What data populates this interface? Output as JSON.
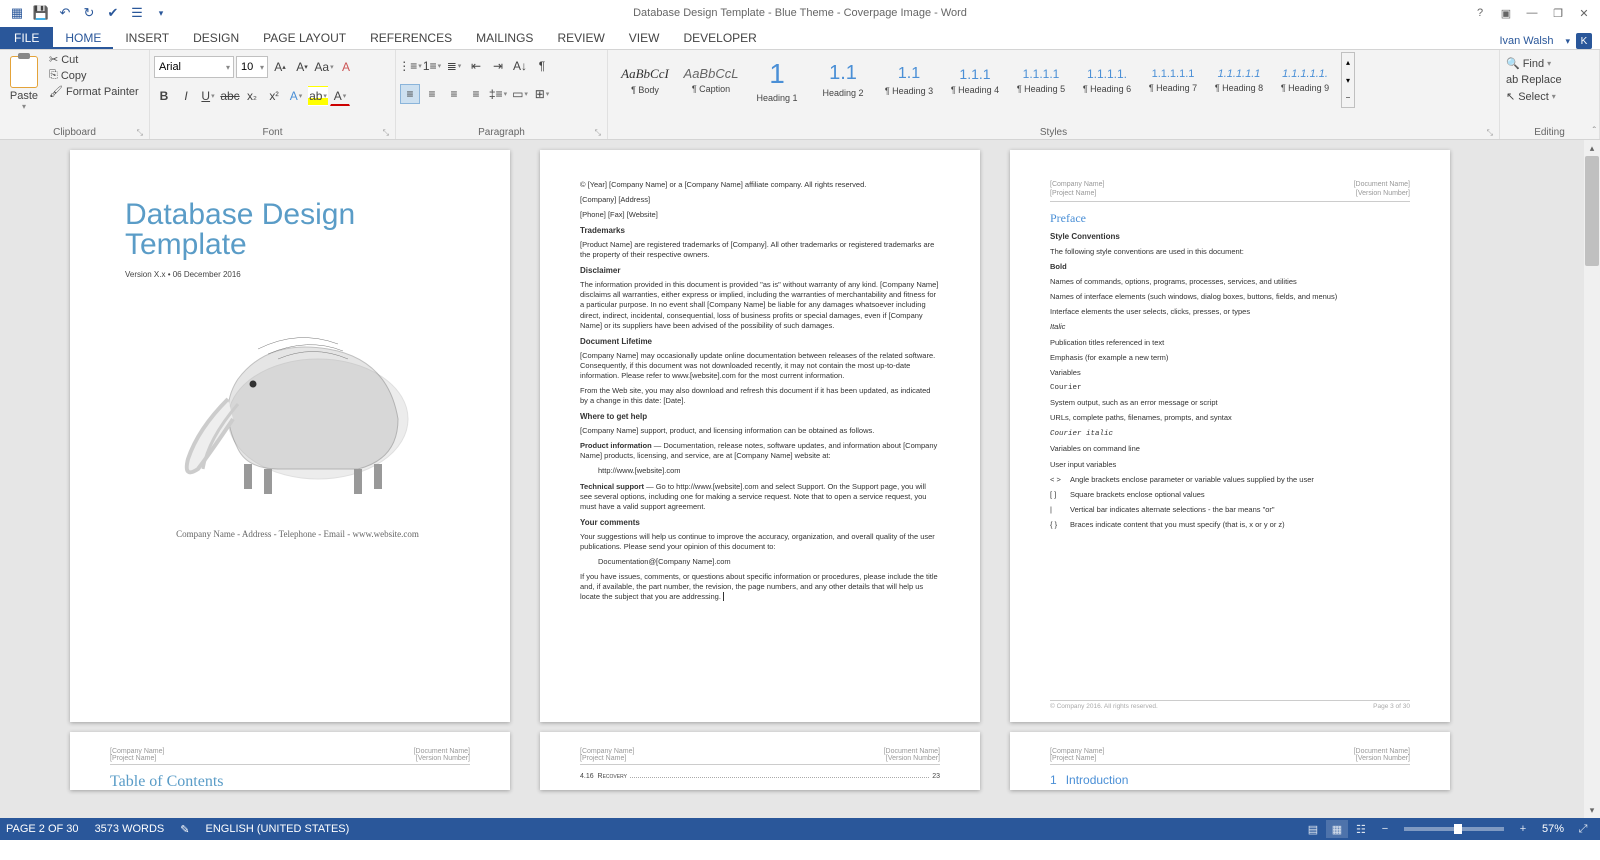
{
  "window": {
    "title": "Database Design Template - Blue Theme - Coverpage Image - Word",
    "user": "Ivan Walsh",
    "user_initial": "K"
  },
  "qat": [
    "word-icon",
    "save-icon",
    "undo-icon",
    "redo-icon",
    "spelling-icon",
    "touch-icon"
  ],
  "tabs": {
    "file": "FILE",
    "items": [
      "HOME",
      "INSERT",
      "DESIGN",
      "PAGE LAYOUT",
      "REFERENCES",
      "MAILINGS",
      "REVIEW",
      "VIEW",
      "DEVELOPER"
    ],
    "active": 0
  },
  "ribbon": {
    "clipboard": {
      "paste": "Paste",
      "cut": "Cut",
      "copy": "Copy",
      "format_painter": "Format Painter",
      "label": "Clipboard"
    },
    "font": {
      "name": "Arial",
      "size": "10",
      "label": "Font"
    },
    "paragraph": {
      "label": "Paragraph"
    },
    "styles": {
      "label": "Styles",
      "items": [
        {
          "preview": "AaBbCcI",
          "name": "¶ Body",
          "style": "font-family:Georgia;font-style:italic;color:#333"
        },
        {
          "preview": "AaBbCcL",
          "name": "¶ Caption",
          "style": "font-style:italic;color:#666"
        },
        {
          "preview": "1",
          "name": "Heading 1",
          "style": "font-size:28px;font-weight:300;color:#4a8fd6"
        },
        {
          "preview": "1.1",
          "name": "Heading 2",
          "style": "font-size:20px;color:#4a8fd6"
        },
        {
          "preview": "1.1",
          "name": "¶ Heading 3",
          "style": "font-size:16px;color:#4a8fd6"
        },
        {
          "preview": "1.1.1",
          "name": "¶ Heading 4",
          "style": "font-size:14px;color:#4a8fd6"
        },
        {
          "preview": "1.1.1.1",
          "name": "¶ Heading 5",
          "style": "font-size:12px;color:#4a8fd6"
        },
        {
          "preview": "1.1.1.1.",
          "name": "¶ Heading 6",
          "style": "font-size:12px;color:#4a8fd6"
        },
        {
          "preview": "1.1.1.1.1",
          "name": "¶ Heading 7",
          "style": "font-size:11px;color:#4a8fd6"
        },
        {
          "preview": "1.1.1.1.1",
          "name": "¶ Heading 8",
          "style": "font-size:11px;font-style:italic;color:#4a8fd6"
        },
        {
          "preview": "1.1.1.1.1.",
          "name": "¶ Heading 9",
          "style": "font-size:11px;font-style:italic;color:#4a8fd6"
        }
      ]
    },
    "editing": {
      "find": "Find",
      "replace": "Replace",
      "select": "Select",
      "label": "Editing"
    }
  },
  "doc": {
    "page1": {
      "title": "Database Design Template",
      "sub": "Version X.x • 06 December 2016",
      "foot": "Company Name - Address - Telephone - Email - www.website.com"
    },
    "page2": {
      "copyright": "© [Year] [Company Name] or a [Company Name] affiliate company. All rights reserved.",
      "addr1": "[Company] [Address]",
      "addr2": "[Phone] [Fax] [Website]",
      "tm_h": "Trademarks",
      "tm": "[Product Name] are registered trademarks of [Company]. All other trademarks or registered trademarks are the property of their respective owners.",
      "dis_h": "Disclaimer",
      "dis": "The information provided in this document is provided \"as is\" without warranty of any kind. [Company Name] disclaims all warranties, either express or implied, including the warranties of merchantability and fitness for a particular purpose. In no event shall [Company Name] be liable for any damages whatsoever including direct, indirect, incidental, consequential, loss of business profits or special damages, even if [Company Name] or its suppliers have been advised of the possibility of such damages.",
      "dl_h": "Document Lifetime",
      "dl1": "[Company Name] may occasionally update online documentation between releases of the related software. Consequently, if this document was not downloaded recently, it may not contain the most up-to-date information. Please refer to www.[website].com for the most current information.",
      "dl2": "From the Web site, you may also download and refresh this document if it has been updated, as indicated by a change in this date: [Date].",
      "help_h": "Where to get help",
      "help": "[Company Name] support, product, and licensing information can be obtained as follows.",
      "pi_h": "Product information",
      "pi": " — Documentation, release notes, software updates, and information about [Company Name] products, licensing, and service, are at [Company Name] website at:",
      "pi_url": "http://www.[website].com",
      "ts_h": "Technical support",
      "ts": " — Go to http://www.[website].com and select Support. On the Support page, you will see several options, including one for making a service request. Note that to open a service request, you must have a valid support agreement.",
      "yc_h": "Your comments",
      "yc1": "Your suggestions will help us continue to improve the accuracy, organization, and overall quality of the user publications. Please send your opinion of this document to:",
      "yc_email": "Documentation@[Company Name].com",
      "yc2": "If you have issues, comments, or questions about specific information or procedures, please include the title and, if available, the part number, the revision, the page numbers, and any other details that will help us locate the subject that you are addressing."
    },
    "page3": {
      "hl": "[Company Name]",
      "hl2": "[Project Name]",
      "hr": "[Document Name]",
      "hr2": "[Version Number]",
      "preface": "Preface",
      "sc": "Style Conventions",
      "sc1": "The following style conventions are used in this document:",
      "b": "Bold",
      "b1": "Names of commands, options, programs, processes, services, and utilities",
      "b2": "Names of interface elements (such windows, dialog boxes, buttons, fields, and menus)",
      "b3": "Interface elements the user selects, clicks, presses, or types",
      "i": "Italic",
      "i1": "Publication titles referenced in text",
      "i2": "Emphasis (for example a new term)",
      "i3": "Variables",
      "c": "Courier",
      "c1": "System output, such as an error message or script",
      "c2": "URLs, complete paths, filenames, prompts, and syntax",
      "ci": "Courier italic",
      "ci1": "Variables on command line",
      "ci2": "User input variables",
      "a1": "< >",
      "a1t": "Angle brackets enclose parameter or variable values supplied by the user",
      "a2": "[ ]",
      "a2t": "Square brackets enclose optional values",
      "a3": "|",
      "a3t": "Vertical bar indicates alternate selections - the bar means \"or\"",
      "a4": "{ }",
      "a4t": "Braces indicate content that you must specify (that is, x or y or z)",
      "foot_l": "© Company 2016. All rights reserved.",
      "foot_r": "Page 3 of 30"
    },
    "page5": {
      "toc_num": "4.16",
      "toc_item": "Recovery",
      "toc_page": "23"
    },
    "page6": {
      "intro_num": "1",
      "intro": "Introduction"
    },
    "toc": "Table of Contents"
  },
  "status": {
    "page": "PAGE 2 OF 30",
    "words": "3573 WORDS",
    "lang": "ENGLISH (UNITED STATES)",
    "zoom": "57%"
  }
}
